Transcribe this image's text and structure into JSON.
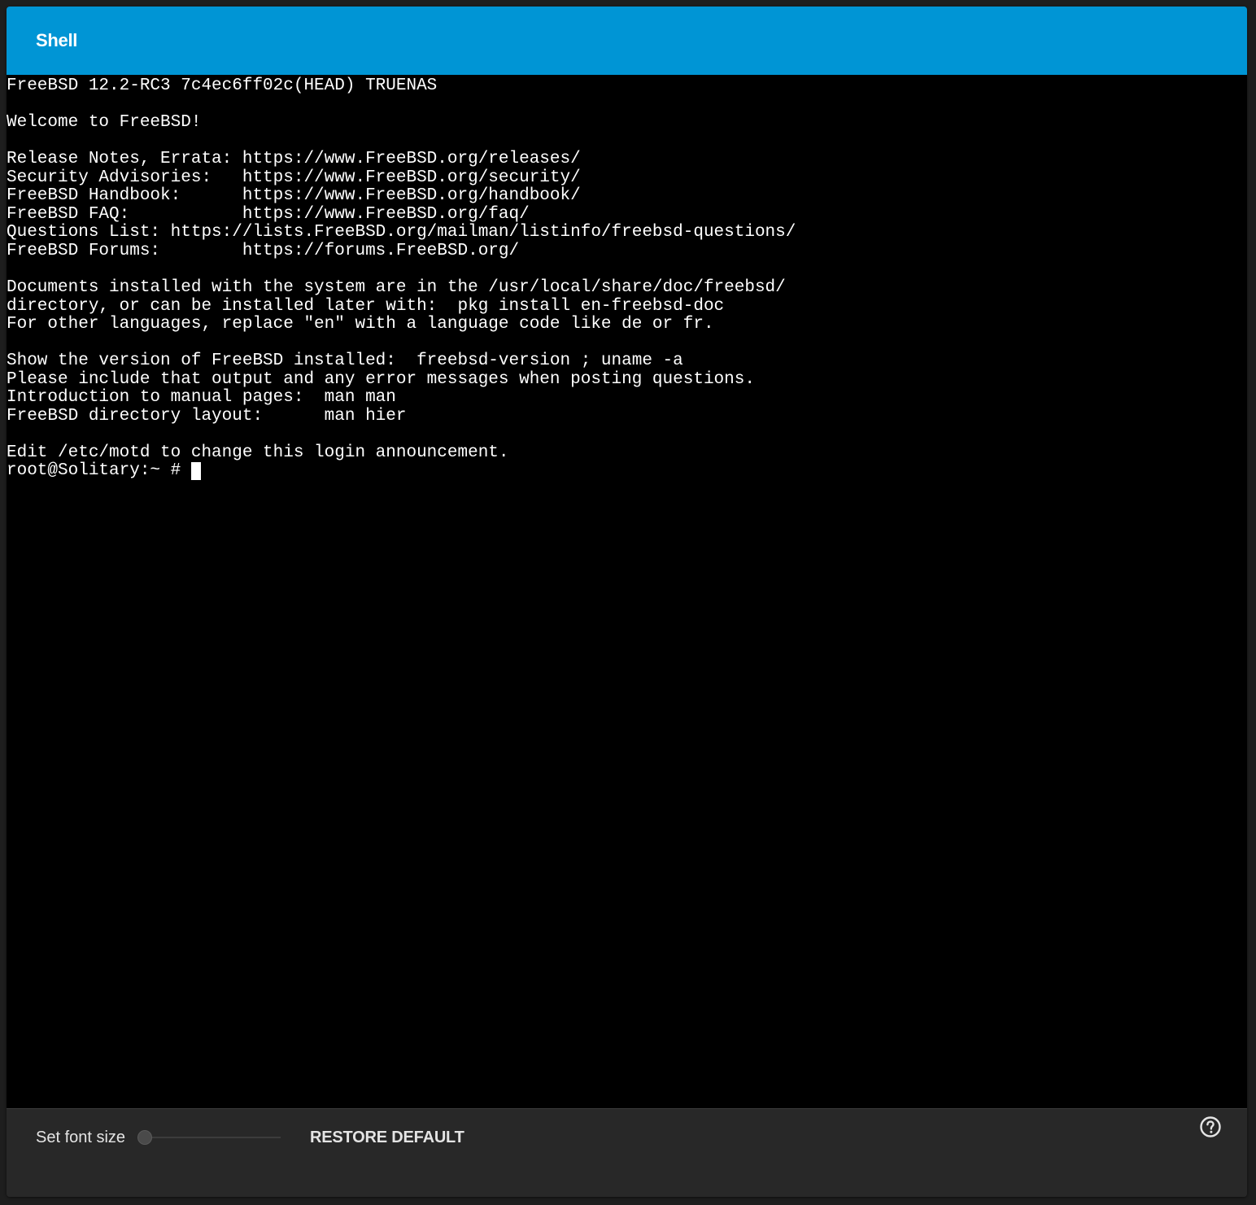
{
  "header": {
    "title": "Shell"
  },
  "terminal": {
    "lines": [
      "FreeBSD 12.2-RC3 7c4ec6ff02c(HEAD) TRUENAS",
      "",
      "Welcome to FreeBSD!",
      "",
      "Release Notes, Errata: https://www.FreeBSD.org/releases/",
      "Security Advisories:   https://www.FreeBSD.org/security/",
      "FreeBSD Handbook:      https://www.FreeBSD.org/handbook/",
      "FreeBSD FAQ:           https://www.FreeBSD.org/faq/",
      "Questions List: https://lists.FreeBSD.org/mailman/listinfo/freebsd-questions/",
      "FreeBSD Forums:        https://forums.FreeBSD.org/",
      "",
      "Documents installed with the system are in the /usr/local/share/doc/freebsd/",
      "directory, or can be installed later with:  pkg install en-freebsd-doc",
      "For other languages, replace \"en\" with a language code like de or fr.",
      "",
      "Show the version of FreeBSD installed:  freebsd-version ; uname -a",
      "Please include that output and any error messages when posting questions.",
      "Introduction to manual pages:  man man",
      "FreeBSD directory layout:      man hier",
      "",
      "Edit /etc/motd to change this login announcement."
    ],
    "prompt": "root@Solitary:~ # "
  },
  "footer": {
    "font_size_label": "Set font size",
    "font_size_slider_level": 0,
    "restore_default_label": "RESTORE DEFAULT",
    "help_icon": "help-circle-icon"
  },
  "colors": {
    "header_background": "#0095d5",
    "terminal_background": "#000000",
    "terminal_text": "#ffffff",
    "panel_background": "#282828"
  }
}
